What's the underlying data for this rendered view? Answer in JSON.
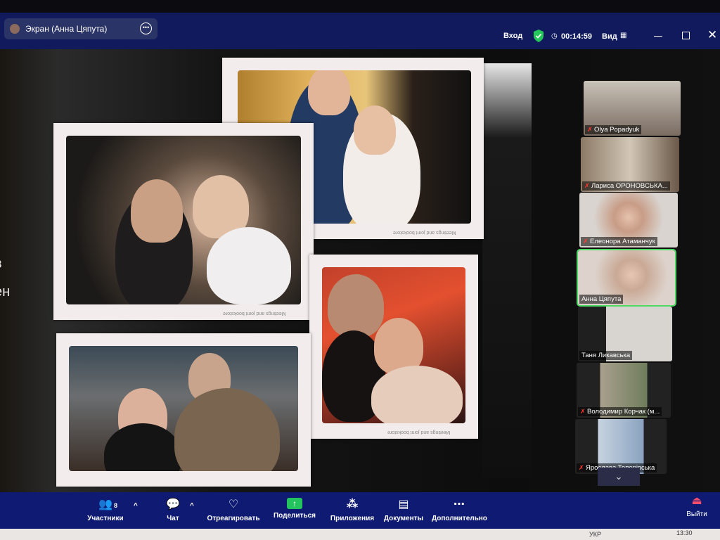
{
  "topbar": {
    "share_label": "Экран (Анна Цяпута)",
    "enter_label": "Вход",
    "timer": "00:14:59",
    "view_label": "Вид",
    "close_glyph": "✕",
    "more_glyph": "•••"
  },
  "slide": {
    "side_text_line1": "в",
    "side_text_line2": "ен",
    "caption": "Meetings and joint bookstore"
  },
  "participants": [
    {
      "name": "Olya Popadyuk",
      "muted": true
    },
    {
      "name": "Лариса ОРОНОВСЬКА...",
      "muted": true
    },
    {
      "name": "Елеонора Атаманчук",
      "muted": true
    },
    {
      "name": "Анна Цяпута",
      "muted": false
    },
    {
      "name": "Таня Ликавська",
      "muted": false
    },
    {
      "name": "Володимир Корчак (м...",
      "muted": true
    },
    {
      "name": "Ярослава Топорівська",
      "muted": true
    }
  ],
  "toolbar": {
    "participants_label": "Участники",
    "participants_count": "8",
    "chat_label": "Чат",
    "react_label": "Отреагировать",
    "share_label": "Поделиться",
    "apps_label": "Приложения",
    "docs_label": "Документы",
    "more_label": "Дополнительно",
    "leave_label": "Выйти",
    "caret": "^",
    "scroll_down_glyph": "⌄"
  },
  "taskbar": {
    "lang": "УКР",
    "time": "13:30"
  },
  "colors": {
    "topbar_bg": "#101a5c",
    "toolbar_bg": "#0f1b73",
    "active_speaker": "#4cd964",
    "muted_mic": "#ff3b30",
    "share_green": "#23c45e"
  }
}
